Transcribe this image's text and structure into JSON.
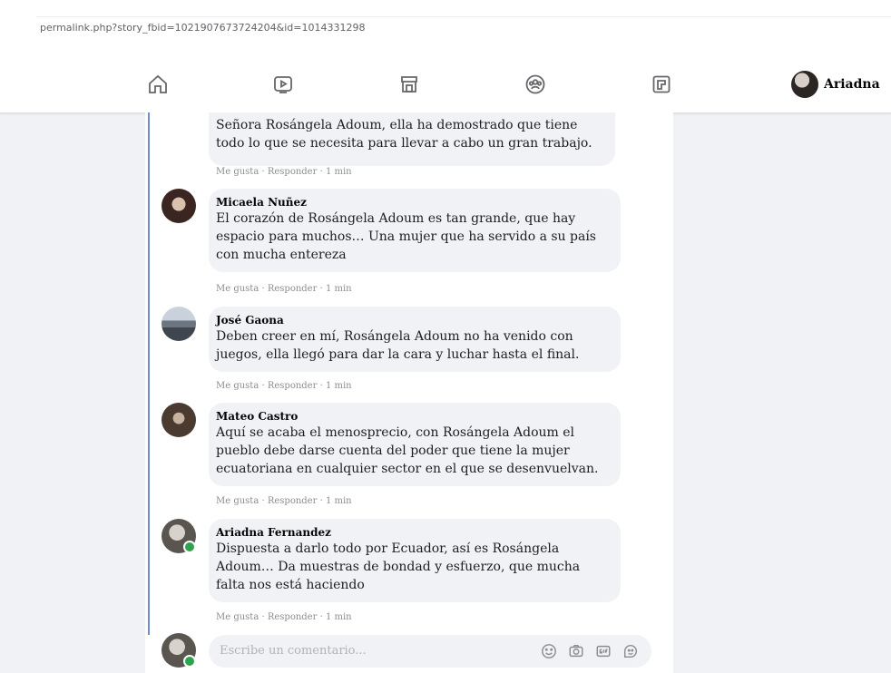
{
  "browser": {
    "url": "permalink.php?story_fbid=1021907673724204&id=1014331298"
  },
  "nav": {
    "icons": [
      "home-icon",
      "watch-video-icon",
      "marketplace-icon",
      "groups-icon",
      "gaming-icon"
    ],
    "profile_name": "Ariadna"
  },
  "comments": [
    {
      "author": "",
      "text": "Señora Rosángela Adoum, ella ha demostrado que tiene todo lo que se necesita para llevar a cabo un gran trabajo.",
      "like": "Me gusta",
      "reply": "Responder",
      "time": "1 min"
    },
    {
      "author": "Micaela Nuñez",
      "text": "El corazón de Rosángela Adoum es tan grande, que hay espacio para muchos… Una mujer que ha servido a su país con mucha entereza",
      "like": "Me gusta",
      "reply": "Responder",
      "time": "1 min"
    },
    {
      "author": "José Gaona",
      "text": "Deben creer en mí, Rosángela Adoum no ha venido con juegos, ella llegó para dar la cara y luchar hasta el final.",
      "like": "Me gusta",
      "reply": "Responder",
      "time": "1 min"
    },
    {
      "author": "Mateo Castro",
      "text": "Aquí se acaba el menosprecio, con Rosángela Adoum el pueblo debe darse cuenta del poder que tiene la mujer ecuatoriana en cualquier sector en el que se desenvuelvan.",
      "like": "Me gusta",
      "reply": "Responder",
      "time": "1 min"
    },
    {
      "author": "Ariadna Fernandez",
      "text": "Dispuesta a darlo todo por Ecuador, así es Rosángela Adoum… Da muestras de bondad y esfuerzo, que mucha falta nos está haciendo",
      "like": "Me gusta",
      "reply": "Responder",
      "time": "1 min"
    }
  ],
  "composer": {
    "placeholder": "Escribe un comentario...",
    "icons": [
      "emoji-icon",
      "camera-icon",
      "gif-icon",
      "sticker-icon"
    ]
  },
  "colors": {
    "thread_line": "#6d8fd1",
    "online_dot": "#31a24c",
    "bubble_bg": "#f0f2f5"
  }
}
